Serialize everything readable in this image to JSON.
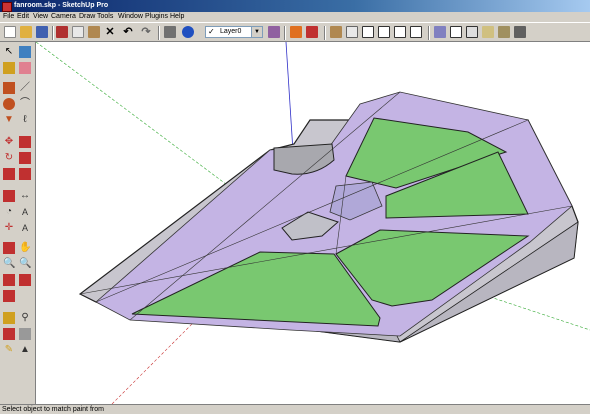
{
  "window": {
    "title": "fanroom.skp - SketchUp Pro"
  },
  "menu": [
    "File",
    "Edit",
    "View",
    "Camera",
    "Draw",
    "Tools",
    "Window",
    "Plugins",
    "Help"
  ],
  "layer": {
    "current": "Layer0"
  },
  "status": {
    "text": "Select object to match paint from"
  },
  "colors": {
    "title_bar": "#0a246a",
    "chrome": "#d4d0c8",
    "surface_gray": "#c8c6ce",
    "surface_purple": "#c4b4e4",
    "green_panel": "#79c870",
    "axis_blue": "#3030c8",
    "axis_red": "#c83030",
    "axis_green": "#30a830"
  },
  "toolbar_icons": [
    "new-icon",
    "open-icon",
    "save-icon",
    "cut-icon",
    "copy-icon",
    "paste-icon",
    "erase-icon",
    "undo-icon",
    "redo-icon",
    "print-icon",
    "model-info-icon",
    "layer-visible-icon",
    "layer-manager-icon",
    "dynamic-components-icon",
    "sandbox-icon",
    "iso-view-icon",
    "top-view-icon",
    "front-view-icon",
    "right-view-icon",
    "back-view-icon",
    "left-view-icon",
    "xray-icon",
    "wireframe-icon",
    "hidden-line-icon",
    "shaded-icon",
    "shaded-textures-icon",
    "monochrome-icon"
  ],
  "left_tools": [
    "select-icon",
    "make-component-icon",
    "paint-bucket-icon",
    "eraser-icon",
    "rectangle-icon",
    "line-icon",
    "circle-icon",
    "arc-icon",
    "polygon-icon",
    "freehand-icon",
    "move-icon",
    "push-pull-icon",
    "rotate-icon",
    "follow-me-icon",
    "scale-icon",
    "offset-icon",
    "tape-measure-icon",
    "dimension-icon",
    "protractor-icon",
    "text-icon",
    "axes-icon",
    "3d-text-icon",
    "orbit-icon",
    "pan-icon",
    "zoom-icon",
    "zoom-window-icon",
    "previous-view-icon",
    "zoom-extents-icon",
    "position-camera-icon",
    "look-around-icon",
    "walk-icon",
    "section-plane-icon",
    "sandbox-smoove-icon",
    "stamp-icon",
    "drape-icon",
    "add-detail-icon"
  ]
}
